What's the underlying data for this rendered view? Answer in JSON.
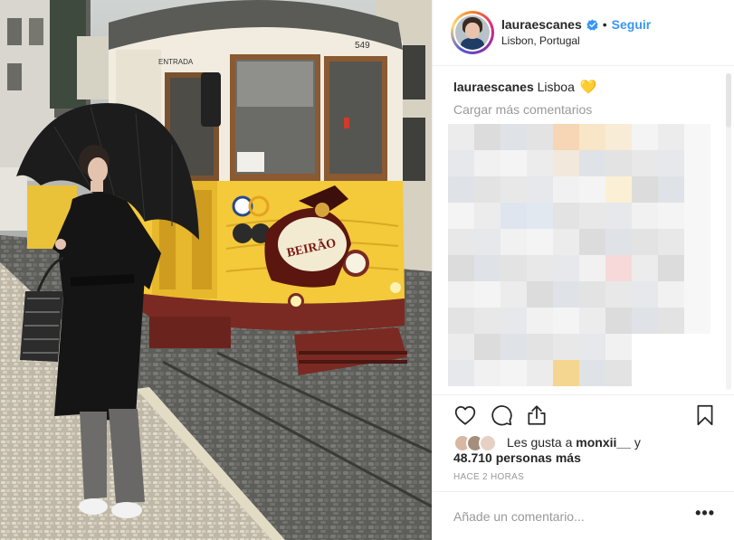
{
  "post": {
    "username": "lauraescanes",
    "verified": true,
    "follow_label": "Seguir",
    "separator": "•",
    "location": "Lisbon, Portugal"
  },
  "photo": {
    "tram_label_entrada": "ENTRADA",
    "tram_number": "549",
    "ad_brand": "BEIRÃO"
  },
  "comments": {
    "caption_user": "lauraescanes",
    "caption_text": "Lisboa",
    "caption_emoji": "💛",
    "load_more_label": "Cargar más comentarios"
  },
  "actions": {
    "like_icon": "heart-icon",
    "comment_icon": "comment-icon",
    "share_icon": "share-icon",
    "save_icon": "bookmark-icon"
  },
  "likes": {
    "prefix": "Les gusta a",
    "first_user": "monxii__",
    "conjunction": "y",
    "others": "48.710 personas más"
  },
  "timestamp": "HACE 2 HORAS",
  "comment_box": {
    "placeholder": "Añade un comentario...",
    "more_label": "•••"
  },
  "colors": {
    "accent": "#3897f0",
    "tram_yellow": "#f4c93a",
    "tram_red": "#7a2a22"
  }
}
